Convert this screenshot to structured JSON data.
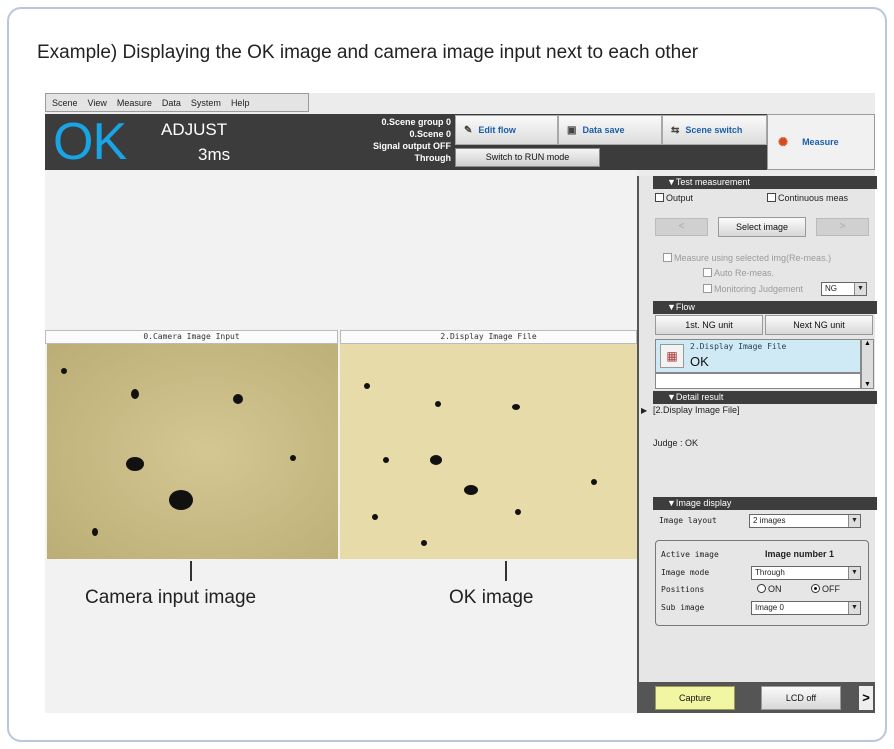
{
  "caption": "Example) Displaying the OK image and camera image input next to each other",
  "menu": [
    "Scene",
    "View",
    "Measure",
    "Data",
    "System",
    "Help"
  ],
  "header": {
    "status": "OK",
    "mode": "ADJUST",
    "time": "3ms",
    "scene_group": "0.Scene group 0",
    "scene": "0.Scene 0",
    "signal_output": "Signal output OFF",
    "through": "Through",
    "switch_mode": "Switch to RUN mode"
  },
  "toolbar": {
    "edit_flow": "Edit flow",
    "data_save": "Data save",
    "scene_switch": "Scene switch",
    "measure": "Measure"
  },
  "images": {
    "left_title": "0.Camera Image Input",
    "right_title": "2.Display Image File",
    "left_label": "Camera input image",
    "right_label": "OK image"
  },
  "test_measurement": {
    "header": "▼Test measurement",
    "output": "Output",
    "continuous": "Continuous meas",
    "prev": "<",
    "select_image": "Select image",
    "next": ">",
    "measure_selected": "Measure using selected img(Re-meas.)",
    "auto_remeas": "Auto Re-meas.",
    "monitoring": "Monitoring Judgement",
    "monitoring_value": "NG"
  },
  "flow": {
    "header": "▼Flow",
    "first_ng": "1st. NG unit",
    "next_ng": "Next NG unit",
    "item_title": "2.Display Image File",
    "item_status": "OK"
  },
  "detail": {
    "header": "▼Detail result",
    "line1": "[2.Display Image File]",
    "line2": "Judge : OK"
  },
  "image_display": {
    "header": "▼Image display",
    "layout_label": "Image layout",
    "layout_value": "2 images",
    "active_label": "Active image",
    "active_value": "Image number 1",
    "mode_label": "Image mode",
    "mode_value": "Through",
    "position_label": "Positions",
    "on": "ON",
    "off": "OFF",
    "sub_label": "Sub image",
    "sub_value": "Image 0"
  },
  "bottom": {
    "capture": "Capture",
    "lcd_off": "LCD off",
    "more": ">"
  },
  "colors": {
    "ok_blue": "#19a4e6",
    "header_dark": "#3c3c3c",
    "capture_yellow": "#f2f5a2"
  }
}
